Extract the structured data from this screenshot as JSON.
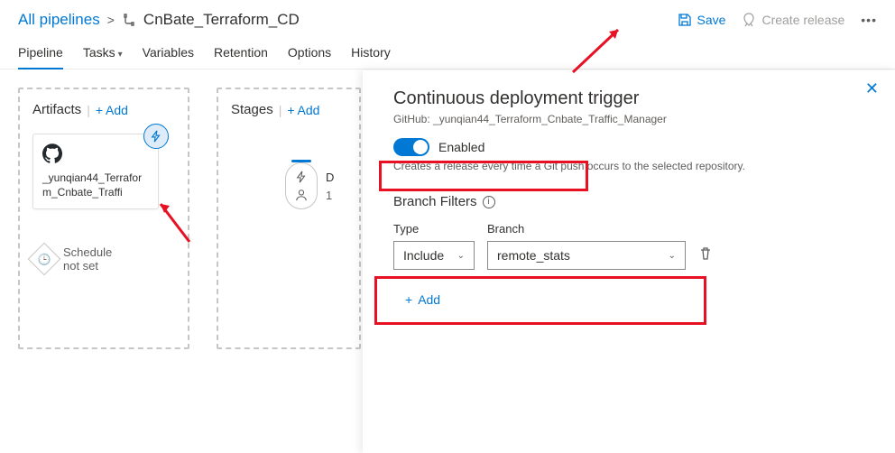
{
  "breadcrumb": {
    "root": "All pipelines",
    "title": "CnBate_Terraform_CD"
  },
  "header": {
    "save": "Save",
    "create_release": "Create release"
  },
  "tabs": {
    "pipeline": "Pipeline",
    "tasks": "Tasks",
    "variables": "Variables",
    "retention": "Retention",
    "options": "Options",
    "history": "History"
  },
  "artifacts": {
    "title": "Artifacts",
    "add": "Add",
    "card_name": "_yunqian44_Terraform_Cnbate_Traffi",
    "schedule_l1": "Schedule",
    "schedule_l2": "not set"
  },
  "stages": {
    "title": "Stages",
    "add": "Add",
    "node_letter": "D",
    "node_count": "1"
  },
  "flyout": {
    "title": "Continuous deployment trigger",
    "subtitle": "GitHub: _yunqian44_Terraform_Cnbate_Traffic_Manager",
    "toggle_label": "Enabled",
    "desc": "Creates a release every time a Git push occurs to the selected repository.",
    "branch_filters": "Branch Filters",
    "type_label": "Type",
    "branch_label": "Branch",
    "type_value": "Include",
    "branch_value": "remote_stats",
    "add": "Add"
  }
}
